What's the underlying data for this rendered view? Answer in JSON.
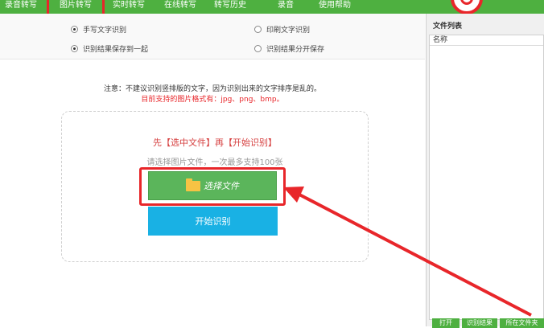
{
  "nav": {
    "tabs": [
      {
        "label": "录音转写"
      },
      {
        "label": "图片转写"
      },
      {
        "label": "实时转写"
      },
      {
        "label": "在线转写"
      },
      {
        "label": "转写历史"
      },
      {
        "label": "录音"
      },
      {
        "label": "使用帮助"
      }
    ],
    "active_tab": "图片转写"
  },
  "options": {
    "handwritten": "手写文字识别",
    "printed": "印刷文字识别",
    "save_together": "识别结果保存到一起",
    "save_separately": "识别结果分开保存"
  },
  "notice": {
    "line1": "注意：不建议识别竖排版的文字，因为识别出来的文字排序是乱的。",
    "line2": "目前支持的图片格式有：jpg、png、bmp。"
  },
  "dropzone": {
    "title": "先【选中文件】再【开始识别】",
    "subtitle": "请选择图片文件，一次最多支持100张",
    "choose_button": "选择文件",
    "start_button": "开始识别"
  },
  "file_panel": {
    "title": "文件列表",
    "column_name": "名称",
    "buttons": [
      "打开",
      "识别结果",
      "所在文件夹"
    ]
  },
  "colors": {
    "green": "#4eb040",
    "blue": "#19b1e4",
    "red": "#e8262a"
  }
}
